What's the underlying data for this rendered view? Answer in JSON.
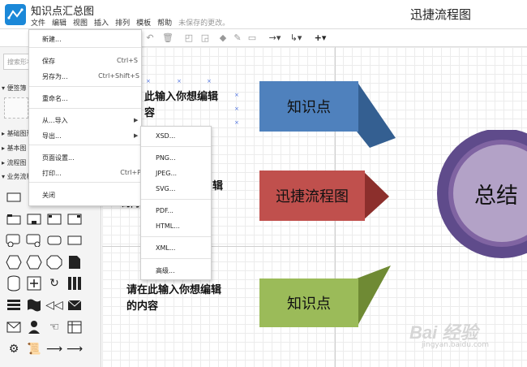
{
  "app": {
    "document_title": "知识点汇总图",
    "brand_title": "迅捷流程图"
  },
  "menubar": [
    {
      "label": "文件"
    },
    {
      "label": "编辑"
    },
    {
      "label": "视图"
    },
    {
      "label": "插入"
    },
    {
      "label": "排列"
    },
    {
      "label": "模板"
    },
    {
      "label": "帮助"
    }
  ],
  "unsaved_notice": "未保存的更改。",
  "toolbar": {
    "icons": [
      "undo-icon",
      "redo-icon",
      "delete-icon",
      "to-front-icon",
      "to-back-icon",
      "fill-color-icon",
      "line-color-icon",
      "shadow-icon",
      "connection-icon",
      "waypoint-icon",
      "insert-icon"
    ]
  },
  "sidebar": {
    "search_placeholder": "搜索形状",
    "categories": [
      "便签簿",
      "基础图形",
      "基本图",
      "流程图",
      "业务流程"
    ]
  },
  "canvas": {
    "text_blocks": [
      "此输入你想编辑",
      "容",
      "辑",
      "的内",
      "请在此输入你想编辑",
      "的内容"
    ],
    "shapes": [
      {
        "label": "知识点",
        "color": "#4f81bd"
      },
      {
        "label": "迅捷流程图",
        "color": "#c0504d"
      },
      {
        "label": "知识点",
        "color": "#9bbb59"
      },
      {
        "label": "总结",
        "color": "#5f4b8b"
      }
    ]
  },
  "file_menu": {
    "items": [
      {
        "label": "新建...",
        "shortcut": ""
      },
      {
        "label": "保存",
        "shortcut": "Ctrl+S"
      },
      {
        "label": "另存为...",
        "shortcut": "Ctrl+Shift+S"
      },
      {
        "label": "重命名...",
        "shortcut": ""
      },
      {
        "label": "从...导入",
        "shortcut": ""
      },
      {
        "label": "导出...",
        "shortcut": ""
      },
      {
        "label": "页面设置...",
        "shortcut": ""
      },
      {
        "label": "打印...",
        "shortcut": "Ctrl+P"
      },
      {
        "label": "关闭",
        "shortcut": ""
      }
    ]
  },
  "export_menu": {
    "items": [
      "XSD...",
      "PNG...",
      "JPEG...",
      "SVG...",
      "PDF...",
      "HTML...",
      "XML...",
      "高级..."
    ]
  },
  "watermark": {
    "text": "Bai 经验",
    "sub": "jingyan.baidu.com"
  }
}
